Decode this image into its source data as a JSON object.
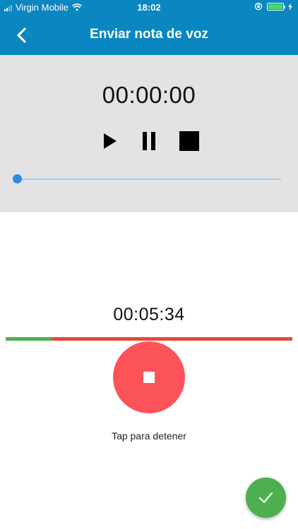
{
  "status_bar": {
    "carrier": "Virgin Mobile",
    "time": "18:02",
    "battery_color": "#4cd964"
  },
  "nav": {
    "title": "Enviar nota de voz",
    "back_icon": "chevron-left-icon",
    "background": "#0a86c0"
  },
  "player": {
    "time": "00:00:00",
    "controls": [
      "play-icon",
      "pause-icon",
      "stop-icon"
    ],
    "seek_progress": 0
  },
  "recorder": {
    "time": "00:05:34",
    "progress": 0.16,
    "progress_color": "#4caf50",
    "remaining_color": "#e8473d",
    "stop_button_color": "#fc5358",
    "hint": "Tap para detener"
  },
  "confirm": {
    "icon": "check-icon",
    "color": "#4caf50"
  }
}
